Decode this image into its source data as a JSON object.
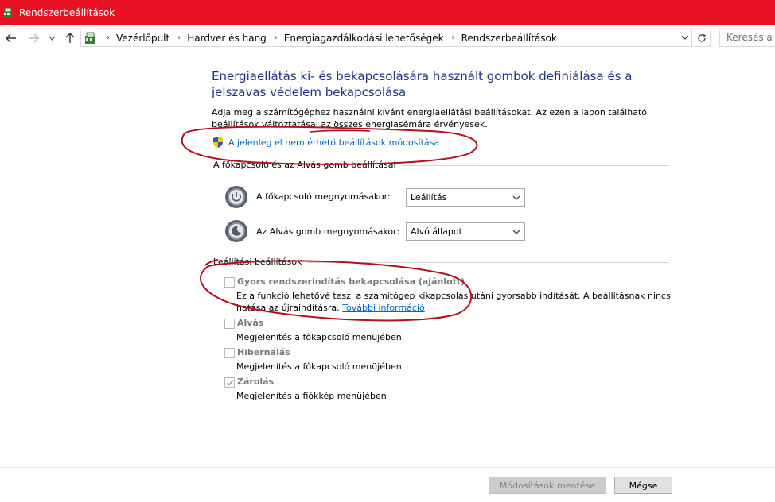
{
  "window": {
    "title": "Rendszerbeállítások",
    "icon": "control-panel-icon"
  },
  "nav": {
    "breadcrumbs": [
      "Vezérlőpult",
      "Hardver és hang",
      "Energiagazdálkodási lehetőségek",
      "Rendszerbeállítások"
    ],
    "search_placeholder": "Keresés a Ve"
  },
  "main": {
    "heading": "Energiaellátás ki- és bekapcsolására használt gombok definiálása és a jelszavas védelem bekapcsolása",
    "intro": "Adja meg a számítógéphez használni kívánt energiaellátási beállításokat. Az ezen a lapon található beállítások változtatásai az összes energiasémára érvényesek.",
    "admin_link": "A jelenleg el nem érhető beállítások módosítása"
  },
  "buttons_group": {
    "title": "A főkapcsoló és az Alvás gomb beállításai",
    "rows": [
      {
        "label": "A főkapcsoló megnyomásakor:",
        "value": "Leállítás",
        "icon": "power-button-icon"
      },
      {
        "label": "Az Alvás gomb megnyomásakor:",
        "value": "Alvó állapot",
        "icon": "sleep-button-icon"
      }
    ]
  },
  "shutdown_group": {
    "title": "Leállítási beállítások",
    "options": [
      {
        "title": "Gyors rendszerindítás bekapcsolása (ajánlott)",
        "desc1": "Ez a funkció lehetővé teszi a számítógép kikapcsolás utáni gyorsabb indítását. A beállításnak nincs",
        "desc2": "hatása az újraindításra.",
        "link": "További információ",
        "checked": false
      },
      {
        "title": "Alvás",
        "desc1": "Megjelenítés a főkapcsoló menüjében.",
        "checked": false
      },
      {
        "title": "Hibernálás",
        "desc1": "Megjelenítés a főkapcsoló menüjében.",
        "checked": false
      },
      {
        "title": "Zárolás",
        "desc1": "Megjelenítés a fiókkép menüjében",
        "checked": true
      }
    ]
  },
  "footer": {
    "save": "Módosítások mentése",
    "cancel": "Mégse"
  },
  "colors": {
    "titlebar": "#e81123",
    "heading": "#1e3287",
    "link": "#0066cc",
    "annotation": "#b30f1c"
  }
}
